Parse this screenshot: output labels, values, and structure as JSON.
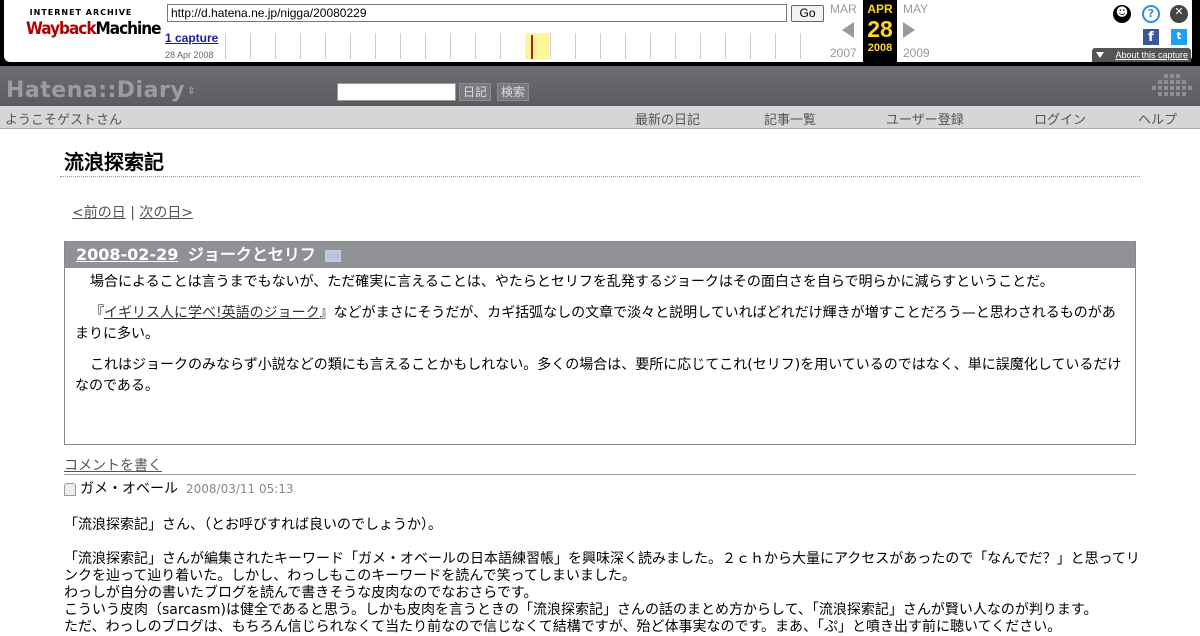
{
  "wayback": {
    "logo_line1": "INTERNET ARCHIVE",
    "logo_line2a": "Wayback",
    "logo_line2b": "Machine",
    "url": "http://d.hatena.ne.jp/nigga/20080229",
    "go_label": "Go",
    "captures": "1 capture",
    "capture_date": "28 Apr 2008",
    "prev_month": "MAR",
    "cur_month": "APR",
    "next_month": "MAY",
    "cur_day": "28",
    "prev_year": "2007",
    "cur_year": "2008",
    "next_year": "2009",
    "about": "About this capture",
    "fb": "f",
    "tw": "t"
  },
  "hatena": {
    "logo": "Hatena::Diary",
    "btn_diary": "日記",
    "btn_search": "検索",
    "welcome": "ようこそゲストさん",
    "nav": [
      "最新の日記",
      "記事一覧",
      "ユーザー登録",
      "ログイン",
      "ヘルプ"
    ]
  },
  "diary": {
    "title": "流浪探索記",
    "prev_day": "<前の日",
    "sep": "|",
    "next_day": "次の日>"
  },
  "entry": {
    "date": "2008-02-29",
    "heading": "ジョークとセリフ",
    "p1": "場合によることは言うまでもないが、ただ確実に言えることは、やたらとセリフを乱発するジョークはその面白さを自らで明らかに減らすということだ。",
    "p2_open": "『",
    "p2_link": "イギリス人に学べ!英語のジョーク",
    "p2_rest": "』などがまさにそうだが、カギ括弧なしの文章で淡々と説明していればどれだけ輝きが増すことだろう—と思わされるものがあまりに多い。",
    "p3": "これはジョークのみならず小説などの類にも言えることかもしれない。多くの場合は、要所に応じてこれ(セリフ)を用いているのではなく、単に誤魔化しているだけなのである。"
  },
  "comments": {
    "write_link": "コメントを書く",
    "author": "ガメ・オベール",
    "timestamp": "2008/03/11 05:13",
    "lines": [
      "「流浪探索記」さん、（とお呼びすれば良いのでしょうか）。",
      "",
      "「流浪探索記」さんが編集されたキーワード「ガメ・オベールの日本語練習帳」を興味深く読みました。２ｃｈから大量にアクセスがあったので「なんでだ？」と思ってリンクを辿って辿り着いた。しかし、わっしもこのキーワードを読んで笑ってしまいました。",
      "わっしが自分の書いたブログを読んで書きそうな皮肉なのでなおさらです。",
      "こういう皮肉（sarcasm)は健全であると思う。しかも皮肉を言うときの「流浪探索記」さんの話のまとめ方からして、「流浪探索記」さんが賢い人なのが判ります。",
      "ただ、わっしのブログは、もちろん信じられなくて当たり前なので信じなくて結構ですが、殆ど体事実なのです。まあ、「ぷ」と噴き出す前に聴いてください。"
    ]
  }
}
